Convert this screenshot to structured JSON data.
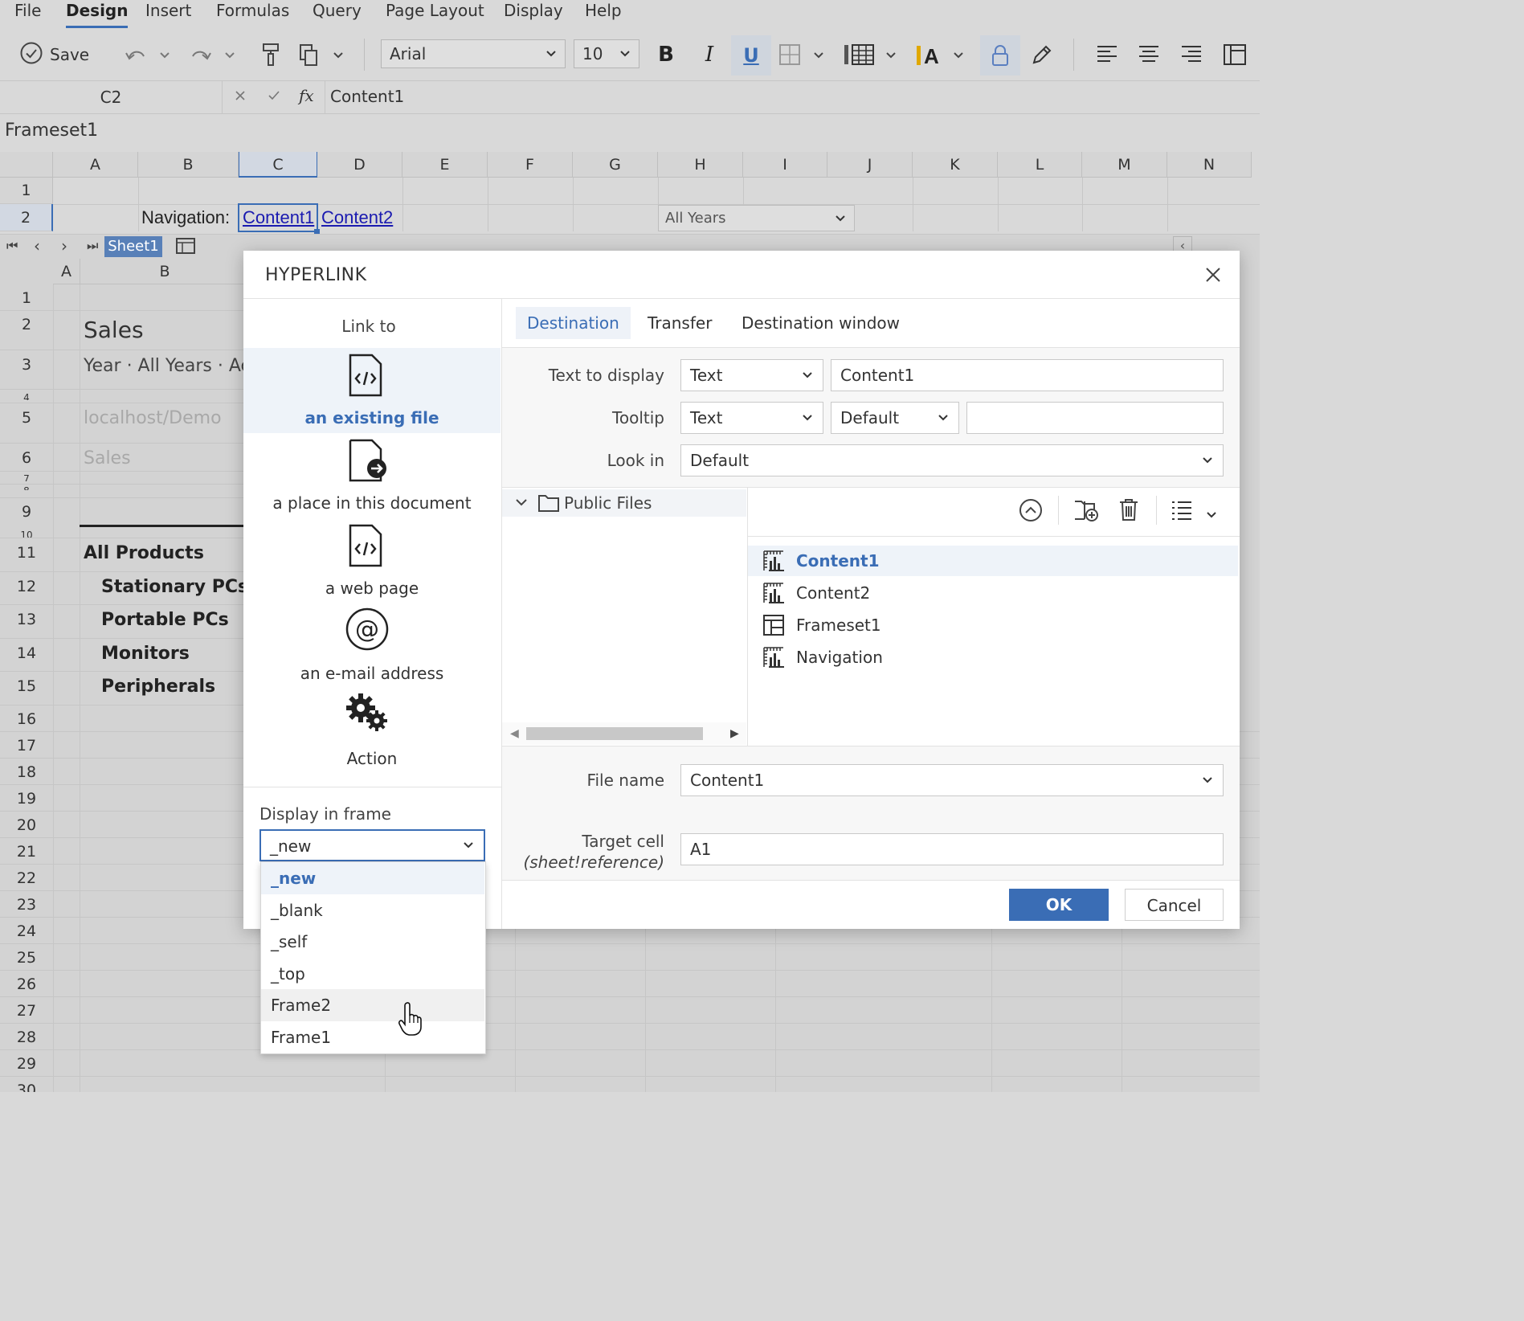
{
  "menu": {
    "items": [
      "File",
      "Design",
      "Insert",
      "Formulas",
      "Query",
      "Page Layout",
      "Display",
      "Help"
    ],
    "active": "Design"
  },
  "toolbar": {
    "save_label": "Save",
    "font": "Arial",
    "font_size": "10"
  },
  "formula_bar": {
    "cell_ref": "C2",
    "formula": "Content1"
  },
  "frameset_label": "Frameset1",
  "top_grid": {
    "columns": [
      "A",
      "B",
      "C",
      "D",
      "E",
      "F",
      "G",
      "H",
      "I",
      "J",
      "K",
      "L",
      "M",
      "N"
    ],
    "rows": [
      "1",
      "2"
    ],
    "navigation_label": "Navigation:",
    "link1": "Content1",
    "link2": "Content2",
    "year_dropdown": "All Years",
    "sheet_tab": "Sheet1"
  },
  "lower_grid": {
    "columns": [
      "A",
      "B"
    ],
    "rows": [
      "1",
      "2",
      "3",
      "4",
      "5",
      "6",
      "7",
      "8",
      "9",
      "10",
      "11",
      "12",
      "13",
      "14",
      "15",
      "16",
      "17",
      "18",
      "19",
      "20",
      "21",
      "22",
      "23",
      "24",
      "25",
      "26",
      "27",
      "28",
      "29",
      "30"
    ],
    "title": "Sales",
    "subtitle": "Year · All Years · Ac",
    "server": "localhost/Demo",
    "cube": "Sales",
    "products": [
      "All Products",
      "Stationary PCs",
      "Portable PCs",
      "Monitors",
      "Peripherals"
    ]
  },
  "dialog": {
    "title": "HYPERLINK",
    "link_to_heading": "Link to",
    "link_options": [
      {
        "label": "an existing file",
        "icon": "code-file-icon"
      },
      {
        "label": "a place in this document",
        "icon": "file-arrow-icon"
      },
      {
        "label": "a web page",
        "icon": "web-page-icon"
      },
      {
        "label": "an e-mail address",
        "icon": "at-sign-icon"
      },
      {
        "label": "Action",
        "icon": "gears-icon"
      }
    ],
    "tabs": [
      "Destination",
      "Transfer",
      "Destination window"
    ],
    "text_to_display_label": "Text to display",
    "text_to_display_type": "Text",
    "text_to_display_value": "Content1",
    "tooltip_label": "Tooltip",
    "tooltip_type": "Text",
    "tooltip_mode": "Default",
    "tooltip_value": "",
    "look_in_label": "Look in",
    "look_in_value": "Default",
    "folder": "Public Files",
    "files": [
      "Content1",
      "Content2",
      "Frameset1",
      "Navigation"
    ],
    "file_name_label": "File name",
    "file_name_value": "Content1",
    "target_cell_label": "Target cell",
    "target_cell_hint": "(sheet!reference)",
    "target_cell_value": "A1",
    "display_in_frame_label": "Display in frame",
    "display_in_frame_value": "_new",
    "frame_options": [
      "_new",
      "_blank",
      "_self",
      "_top",
      "Frame2",
      "Frame1"
    ],
    "ok_label": "OK",
    "cancel_label": "Cancel"
  },
  "colors": {
    "accent": "#3a6db5",
    "background": "#d9d9d9",
    "link": "#1a1ab0"
  }
}
